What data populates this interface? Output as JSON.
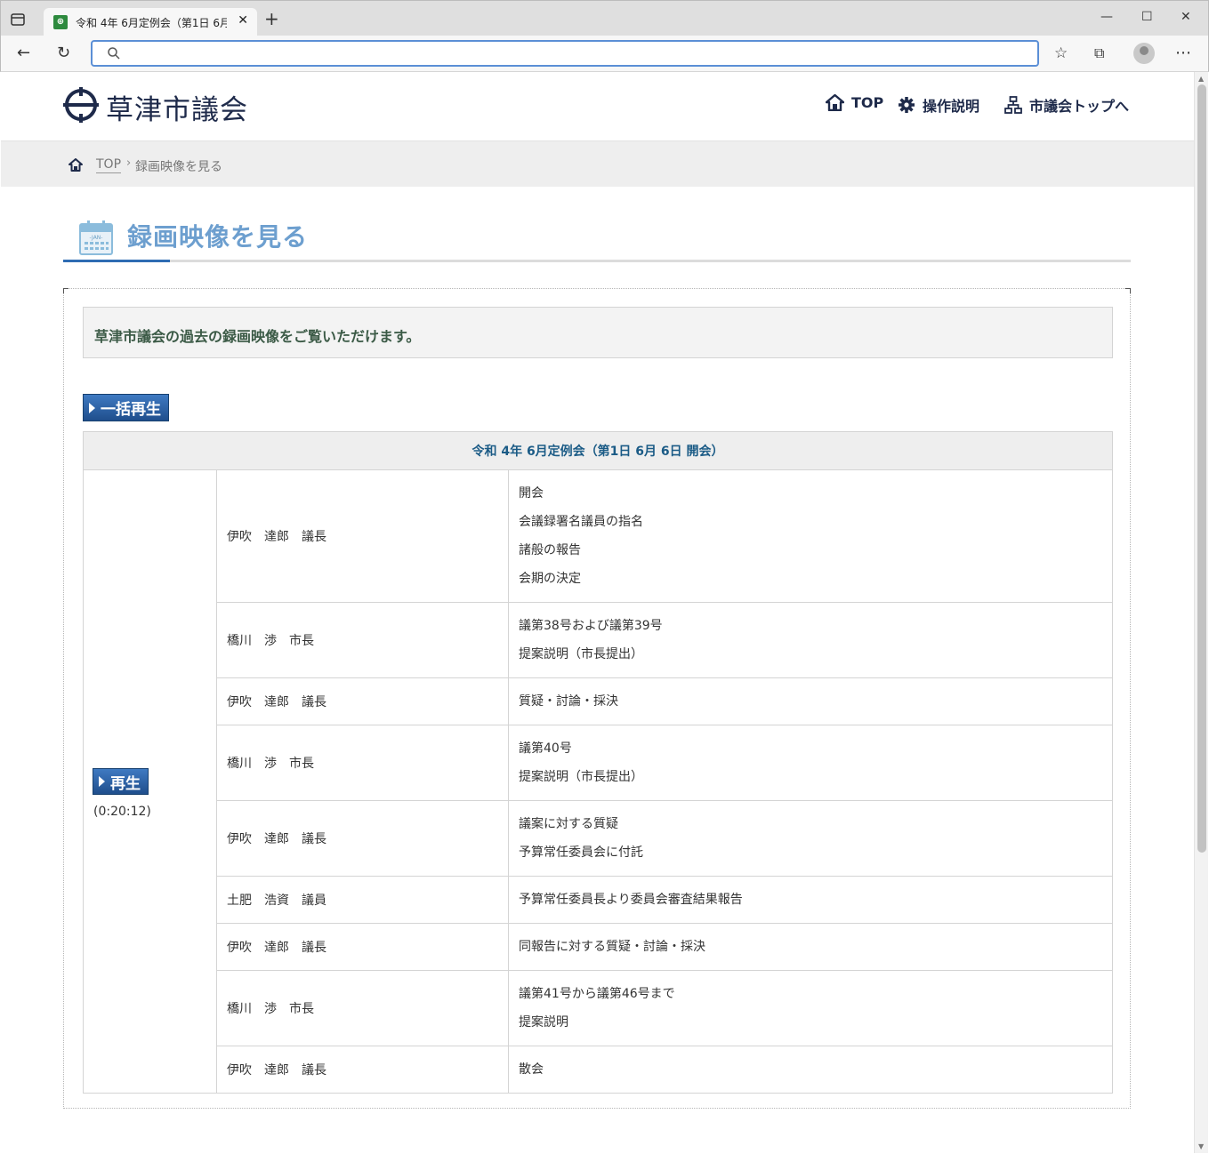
{
  "browser": {
    "tab_title": "令和 4年 6月定例会（第1日 6月",
    "favicon_char": "⊕",
    "address": ""
  },
  "site": {
    "logo_text": "草津市議会",
    "nav": {
      "top": "TOP",
      "help": "操作説明",
      "council_top": "市議会トップへ"
    },
    "breadcrumb": {
      "top": "TOP",
      "sep": "›",
      "current": "録画映像を見る"
    },
    "page_title": "録画映像を見る",
    "calendar_label": "-JAN-",
    "intro": "草津市議会の過去の録画映像をご覧いただけます。",
    "bulk_play_label": "一括再生",
    "play_label": "再生",
    "duration": "(0:20:12)"
  },
  "session": {
    "header": "令和 4年 6月定例会（第1日 6月 6日 開会）",
    "rows": [
      {
        "speaker": "伊吹　達郎　議長",
        "items": [
          "開会",
          "会議録署名議員の指名",
          "諸般の報告",
          "会期の決定"
        ]
      },
      {
        "speaker": "橋川　渉　市長",
        "items": [
          "議第38号および議第39号",
          "提案説明（市長提出）"
        ]
      },
      {
        "speaker": "伊吹　達郎　議長",
        "items": [
          "質疑・討論・採決"
        ]
      },
      {
        "speaker": "橋川　渉　市長",
        "items": [
          "議第40号",
          "提案説明（市長提出）"
        ]
      },
      {
        "speaker": "伊吹　達郎　議長",
        "items": [
          "議案に対する質疑",
          "予算常任委員会に付託"
        ]
      },
      {
        "speaker": "土肥　浩資　議員",
        "items": [
          "予算常任委員長より委員会審査結果報告"
        ]
      },
      {
        "speaker": "伊吹　達郎　議長",
        "items": [
          "同報告に対する質疑・討論・採決"
        ]
      },
      {
        "speaker": "橋川　渉　市長",
        "items": [
          "議第41号から議第46号まで",
          "提案説明"
        ]
      },
      {
        "speaker": "伊吹　達郎　議長",
        "items": [
          "散会"
        ]
      }
    ]
  },
  "colors": {
    "navy": "#1e2a4a",
    "accent_blue": "#2e6cb3",
    "title_blue": "#6d9fcf",
    "header_text": "#1b5b86"
  }
}
